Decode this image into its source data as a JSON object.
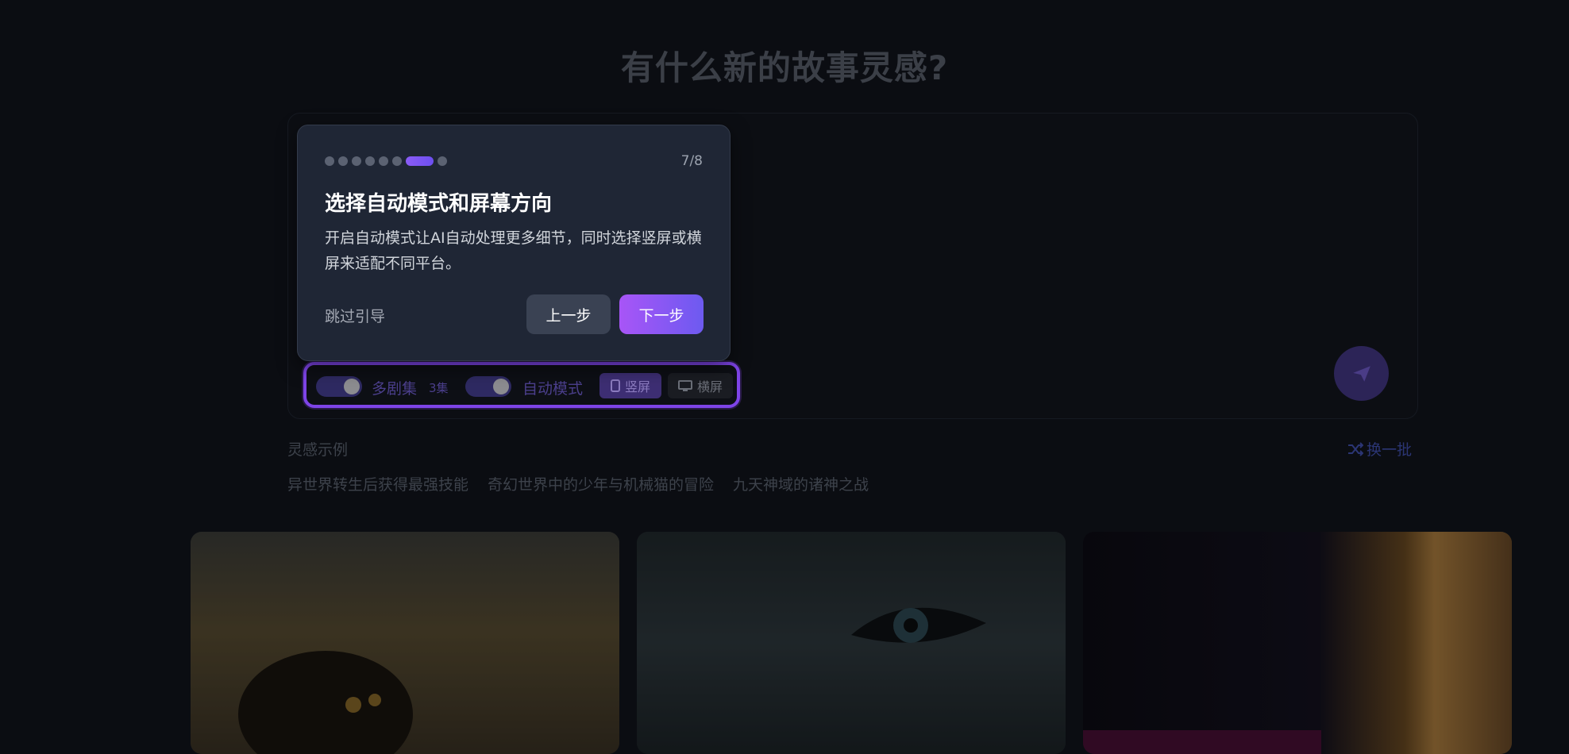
{
  "page": {
    "title": "有什么新的故事灵感?"
  },
  "options": {
    "multi_episode_label": "多剧集",
    "episode_count": "3集",
    "auto_mode_label": "自动模式",
    "portrait_label": "竖屏",
    "landscape_label": "横屏"
  },
  "inspiration": {
    "section_label": "灵感示例",
    "shuffle_label": "换一批",
    "examples": [
      "异世界转生后获得最强技能",
      "奇幻世界中的少年与机械猫的冒险",
      "九天神域的诸神之战"
    ]
  },
  "tour": {
    "step_counter": "7/8",
    "total_steps": 8,
    "current_step": 7,
    "title": "选择自动模式和屏幕方向",
    "description": "开启自动模式让AI自动处理更多细节，同时选择竖屏或横屏来适配不同平台。",
    "skip_label": "跳过引导",
    "prev_label": "上一步",
    "next_label": "下一步"
  },
  "colors": {
    "accent": "#8b5cf6",
    "highlight_border": "#7e44e8",
    "background": "#0b0d12"
  }
}
